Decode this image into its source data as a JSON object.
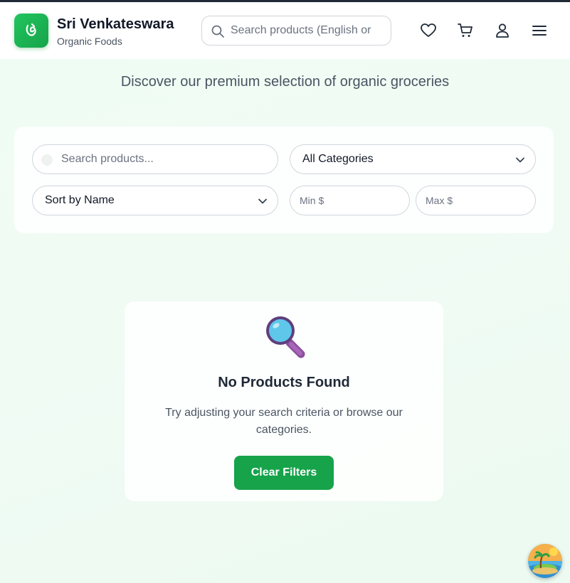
{
  "brand": {
    "title": "Sri Venkateswara",
    "subtitle": "Organic Foods",
    "logo_icon": "leaf-icon",
    "accent": "#16a34a"
  },
  "header": {
    "search_placeholder": "Search products (English or",
    "icons": [
      "heart-icon",
      "cart-icon",
      "user-icon",
      "menu-icon"
    ]
  },
  "hero": {
    "subtitle": "Discover our premium selection of organic groceries"
  },
  "filters": {
    "search_placeholder": "Search products...",
    "category_selected": "All Categories",
    "sort_selected": "Sort by Name",
    "min_placeholder": "Min $",
    "max_placeholder": "Max $"
  },
  "empty_state": {
    "icon": "magnifier-icon",
    "title": "No Products Found",
    "description": "Try adjusting your search criteria or browse our categories.",
    "button_label": "Clear Filters"
  },
  "floating": {
    "icon": "island-icon"
  }
}
